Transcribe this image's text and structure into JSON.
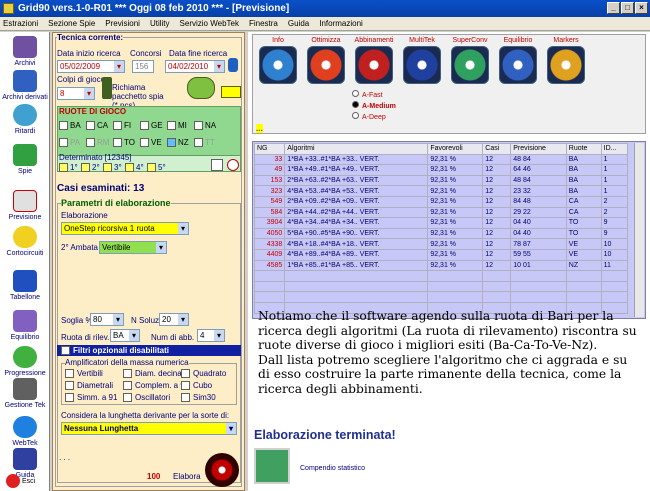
{
  "window": {
    "title": "Grid90 vers.1-0-R01  ***  Oggi 08 feb 2010  ***  - [Previsione]",
    "buttons": [
      "_",
      "□",
      "×"
    ]
  },
  "menu": [
    "Estrazioni",
    "Sezione Spie",
    "Previsioni",
    "Utility",
    "Servizio WebTek",
    "Finestra",
    "Guida",
    "Informazioni"
  ],
  "sidebar": [
    "Archivi",
    "Archivi derivati",
    "Ritardi",
    "Spie",
    "Previsione",
    "Cortocircuiti",
    "Tabellone",
    "Equilibrio",
    "Progressione",
    "Gestione Tek",
    "WebTek",
    "Guida",
    "Esci"
  ],
  "panel": {
    "title": "Tecnica corrente:",
    "data_inizio_lbl": "Data inizio ricerca",
    "concorsi_lbl": "Concorsi",
    "data_fine_lbl": "Data fine ricerca",
    "data_inizio": "05/02/2009",
    "concorsi": "156",
    "data_fine": "04/02/2010",
    "colpi_lbl": "Colpi di gioco",
    "colpi": "8",
    "pacchetto_lbl": "Richiama pacchetto spia (*.pcs)",
    "ruote_title": "RUOTE DI GIOCO",
    "ruote": [
      "BA",
      "CA",
      "FI",
      "GE",
      "MI",
      "NA",
      "PA",
      "RM",
      "TO",
      "VE",
      "NZ",
      "TT"
    ],
    "determinato": "Determinato [12345]",
    "det_items": [
      "1°",
      "2°",
      "3°",
      "4°",
      "5°"
    ],
    "casi": "Casi esaminati: 13",
    "param_title": "Parametri di elaborazione",
    "elab_lbl": "Elaborazione",
    "elab_val": "OneStep ricorsiva 1 ruota",
    "ambata_lbl": "2° Ambata",
    "ambata_val": "Vertibile",
    "soglia_lbl": "Soglia %",
    "soglia": "80",
    "nsoluz_lbl": "N Soluz.",
    "nsoluz": "20",
    "ruota_lbl": "Ruota di rilev.",
    "ruota": "BA",
    "numabb_lbl": "Num di abb.",
    "numabb": "4",
    "filtri": "Filtri opzionali disabilitati",
    "ampl_title": "Amplificatori della massa numerica",
    "ampl": [
      "Vertibili",
      "Diam. decina",
      "Quadrato",
      "Diametrali",
      "Complem. a 90",
      "Cubo",
      "Simm. a 91",
      "Oscillatori",
      "Sim30"
    ],
    "lunghetta_lbl": "Considera la lunghetta derivante per la sorte di:",
    "lunghetta": "Nessuna Lunghetta",
    "dots": ". . .",
    "count": "100",
    "elabora": "Elabora"
  },
  "toolbar": [
    "Info",
    "Ottimizza",
    "Abbinamenti",
    "MultiTek",
    "SuperConv",
    "Equilibrio",
    "Markers"
  ],
  "algos": [
    "A-Fast",
    "A-Medium",
    "A-Deep"
  ],
  "table": {
    "headers": [
      "NG",
      "Algoritmi",
      "Favorevoli",
      "Casi",
      "Previsione",
      "Ruote",
      "ID..."
    ],
    "rows": [
      [
        "33",
        "1*BA +33..#1*BA +33.. VERT.",
        "92,31 %",
        "12",
        "48 84",
        "BA",
        "1"
      ],
      [
        "49",
        "1*BA +49..#1*BA +49.. VERT.",
        "92,31 %",
        "12",
        "64 46",
        "BA",
        "1"
      ],
      [
        "153",
        "2*BA +63..#2*BA +63.. VERT.",
        "92,31 %",
        "12",
        "48 84",
        "BA",
        "1"
      ],
      [
        "323",
        "4*BA +53..#4*BA +53.. VERT.",
        "92,31 %",
        "12",
        "23 32",
        "BA",
        "1"
      ],
      [
        "549",
        "2*BA +09..#2*BA +09.. VERT.",
        "92,31 %",
        "12",
        "84 48",
        "CA",
        "2"
      ],
      [
        "584",
        "2*BA +44..#2*BA +44.. VERT.",
        "92,31 %",
        "12",
        "29 22",
        "CA",
        "2"
      ],
      [
        "3904",
        "4*BA +34..#4*BA +34.. VERT.",
        "92,31 %",
        "12",
        "04 40",
        "TO",
        "9"
      ],
      [
        "4050",
        "5*BA +90..#5*BA +90.. VERT.",
        "92,31 %",
        "12",
        "04 40",
        "TO",
        "9"
      ],
      [
        "4338",
        "4*BA +18..#4*BA +18.. VERT.",
        "92,31 %",
        "12",
        "78 87",
        "VE",
        "10"
      ],
      [
        "4409",
        "4*BA +89..#4*BA +89.. VERT.",
        "92,31 %",
        "12",
        "59 55",
        "VE",
        "10"
      ],
      [
        "4585",
        "1*BA +85..#1*BA +85.. VERT.",
        "92,31 %",
        "12",
        "10 01",
        "NZ",
        "11"
      ]
    ]
  },
  "note": "Notiamo che il software agendo sulla ruota di Bari per la ricerca degli algoritmi (La ruota di rilevamento) riscontra su ruote diverse di gioco i migliori esiti (Ba-Ca-To-Ve-Nz).\nDall lista potremo scegliere l'algoritmo che ci aggrada e su di esso costruire la parte rimanente della tecnica, come la ricerca degli abbinamenti.",
  "done": "Elaborazione terminata!",
  "compendio": "Compendio statistico"
}
